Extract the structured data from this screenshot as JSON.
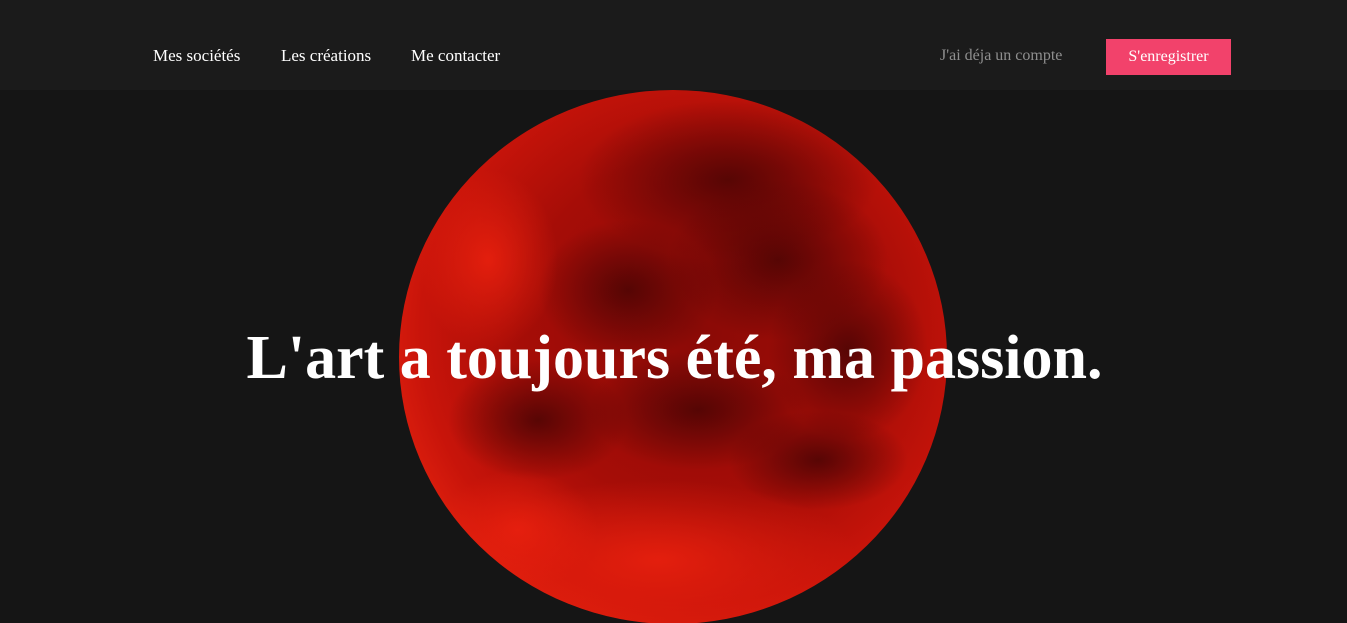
{
  "nav": {
    "links": [
      "Mes sociétés",
      "Les créations",
      "Me contacter"
    ],
    "login_label": "J'ai déja un compte",
    "register_label": "S'enregistrer"
  },
  "hero": {
    "title": "L'art a toujours été, ma passion.",
    "background_image": "red-moon-image"
  },
  "colors": {
    "page_background": "#151515",
    "navbar_background": "#1b1b1b",
    "accent": "#f2426b",
    "login_text": "#8f8f8f",
    "moon_red": "#c01208"
  }
}
